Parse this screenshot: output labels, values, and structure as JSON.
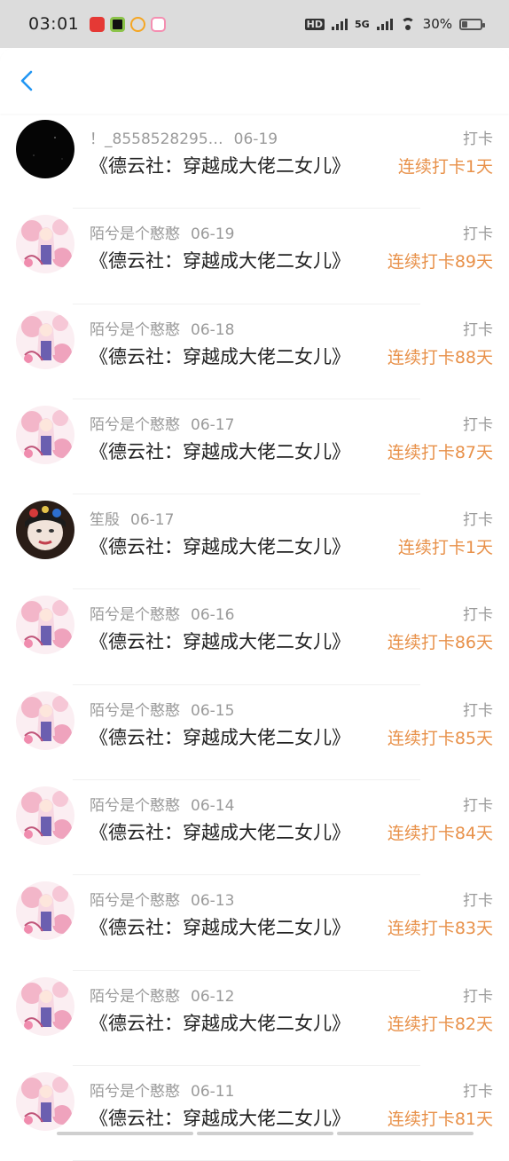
{
  "status_bar": {
    "time": "03:01",
    "hd_label": "HD",
    "net_label": "5G",
    "battery": "30%",
    "battery_level": 0.3,
    "notification_icons": [
      "netease-music-icon",
      "app-icon",
      "weibo-icon",
      "pink-app-icon"
    ]
  },
  "nav": {
    "back_icon": "chevron-left-icon",
    "accent": "#2196f3"
  },
  "colors": {
    "streak": "#e8914a",
    "meta": "#9a9a9a"
  },
  "entries": [
    {
      "user": "！_8558528295…",
      "date": "06-19",
      "book": "《德云社：穿越成大佬二女儿》",
      "tag": "打卡",
      "streak": "连续打卡1天",
      "avatar": "dark-sky-avatar"
    },
    {
      "user": "陌兮是个憨憨",
      "date": "06-19",
      "book": "《德云社：穿越成大佬二女儿》",
      "tag": "打卡",
      "streak": "连续打卡89天",
      "avatar": "anime-girl-avatar"
    },
    {
      "user": "陌兮是个憨憨",
      "date": "06-18",
      "book": "《德云社：穿越成大佬二女儿》",
      "tag": "打卡",
      "streak": "连续打卡88天",
      "avatar": "anime-girl-avatar"
    },
    {
      "user": "陌兮是个憨憨",
      "date": "06-17",
      "book": "《德云社：穿越成大佬二女儿》",
      "tag": "打卡",
      "streak": "连续打卡87天",
      "avatar": "anime-girl-avatar"
    },
    {
      "user": "笙殷",
      "date": "06-17",
      "book": "《德云社：穿越成大佬二女儿》",
      "tag": "打卡",
      "streak": "连续打卡1天",
      "avatar": "opera-face-avatar"
    },
    {
      "user": "陌兮是个憨憨",
      "date": "06-16",
      "book": "《德云社：穿越成大佬二女儿》",
      "tag": "打卡",
      "streak": "连续打卡86天",
      "avatar": "anime-girl-avatar"
    },
    {
      "user": "陌兮是个憨憨",
      "date": "06-15",
      "book": "《德云社：穿越成大佬二女儿》",
      "tag": "打卡",
      "streak": "连续打卡85天",
      "avatar": "anime-girl-avatar"
    },
    {
      "user": "陌兮是个憨憨",
      "date": "06-14",
      "book": "《德云社：穿越成大佬二女儿》",
      "tag": "打卡",
      "streak": "连续打卡84天",
      "avatar": "anime-girl-avatar"
    },
    {
      "user": "陌兮是个憨憨",
      "date": "06-13",
      "book": "《德云社：穿越成大佬二女儿》",
      "tag": "打卡",
      "streak": "连续打卡83天",
      "avatar": "anime-girl-avatar"
    },
    {
      "user": "陌兮是个憨憨",
      "date": "06-12",
      "book": "《德云社：穿越成大佬二女儿》",
      "tag": "打卡",
      "streak": "连续打卡82天",
      "avatar": "anime-girl-avatar"
    },
    {
      "user": "陌兮是个憨憨",
      "date": "06-11",
      "book": "《德云社：穿越成大佬二女儿》",
      "tag": "打卡",
      "streak": "连续打卡81天",
      "avatar": "anime-girl-avatar"
    }
  ]
}
